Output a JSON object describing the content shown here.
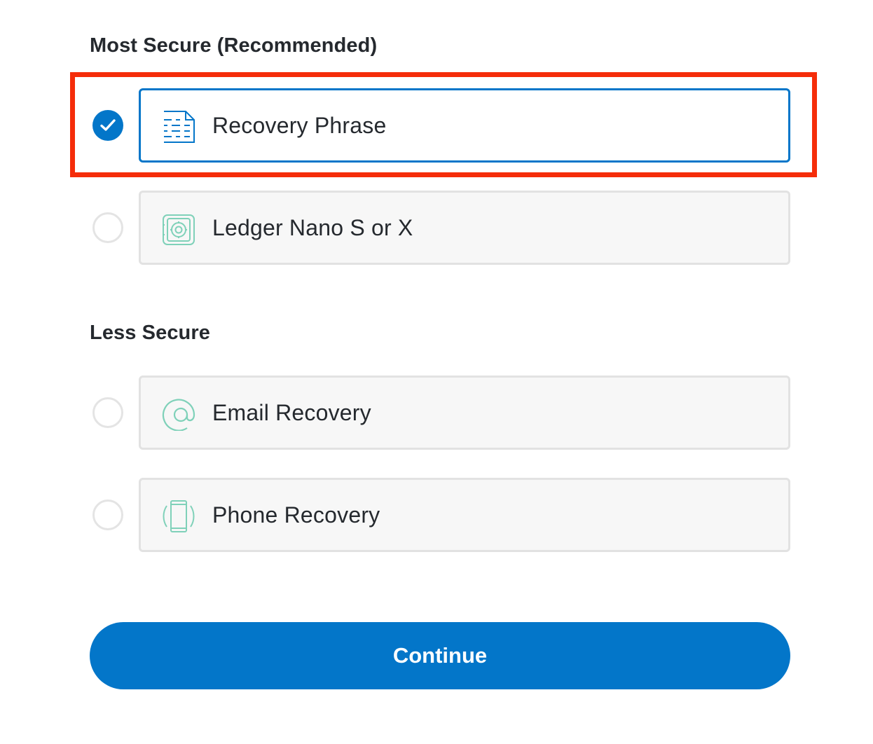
{
  "sections": [
    {
      "heading": "Most Secure (Recommended)",
      "options": [
        {
          "label": "Recovery Phrase",
          "icon": "document-lines-icon",
          "selected": true
        },
        {
          "label": "Ledger Nano S or X",
          "icon": "ledger-device-icon",
          "selected": false
        }
      ]
    },
    {
      "heading": "Less Secure",
      "options": [
        {
          "label": "Email Recovery",
          "icon": "at-sign-icon",
          "selected": false
        },
        {
          "label": "Phone Recovery",
          "icon": "phone-icon",
          "selected": false
        }
      ]
    }
  ],
  "continue_label": "Continue",
  "colors": {
    "accent": "#0376c9",
    "icon_inactive": "#7fd1b9",
    "card_border": "#e2e2e2",
    "card_background": "#f7f7f7",
    "highlight": "#f52d0a"
  }
}
